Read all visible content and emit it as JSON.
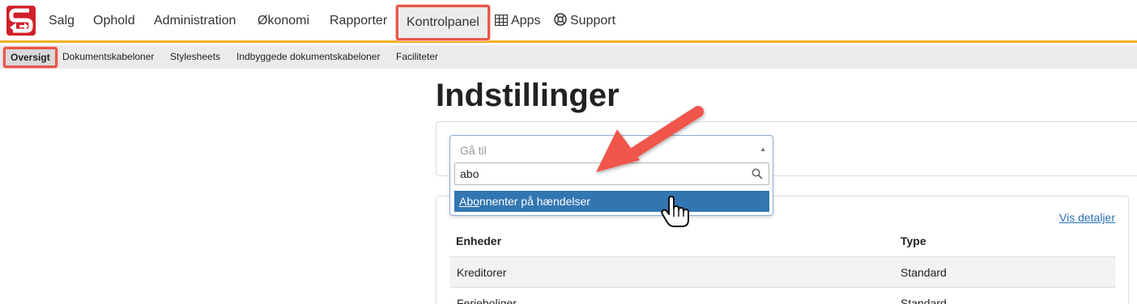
{
  "colors": {
    "brand": "#d1202a",
    "accent": "#f2b01e",
    "highlight": "#e8564a",
    "selected": "#3276b1",
    "link": "#2a6fb5"
  },
  "topnav": {
    "logo_icon": "logo-s-icon",
    "items": [
      "Salg",
      "Ophold",
      "Administration",
      "Økonomi",
      "Rapporter",
      "Kontrolpanel"
    ],
    "apps_label": "Apps",
    "apps_icon": "grid-icon",
    "support_label": "Support",
    "support_icon": "lifebuoy-icon"
  },
  "subnav": {
    "items": [
      "Oversigt",
      "Dokumentskabeloner",
      "Stylesheets",
      "Indbyggede dokumentskabeloner",
      "Faciliteter"
    ]
  },
  "page": {
    "title": "Indstillinger"
  },
  "goto": {
    "placeholder": "Gå til",
    "search_value": "abo",
    "option_match": "Abo",
    "option_rest": "nnenter på hændelser"
  },
  "details_link": "Vis detaljer",
  "table": {
    "headers": [
      "Enheder",
      "Type"
    ],
    "rows": [
      [
        "Kreditorer",
        "Standard"
      ],
      [
        "Ferieboliger",
        "Standard"
      ]
    ]
  }
}
